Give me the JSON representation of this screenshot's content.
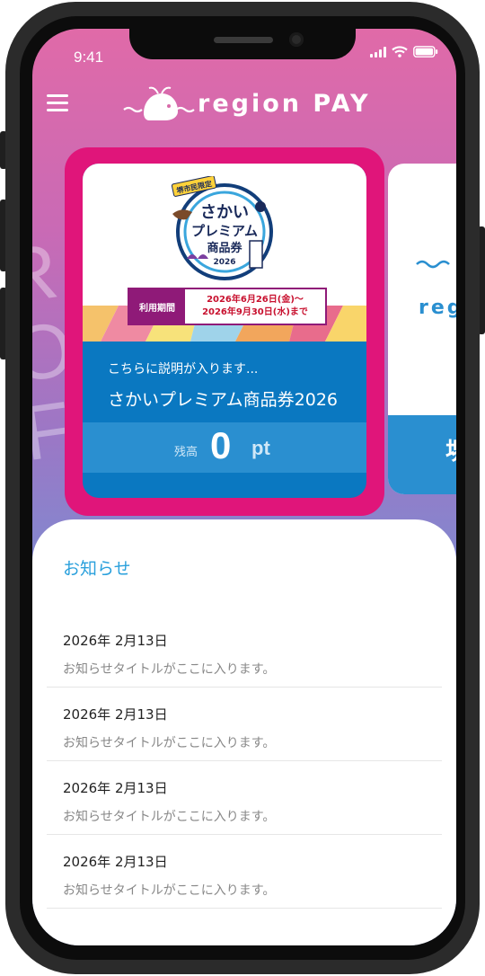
{
  "status_bar": {
    "time": "9:41"
  },
  "app": {
    "logo_text": "region PAY"
  },
  "card": {
    "period_label": "利用期間",
    "period_line1": "2026年6月26日(金)～",
    "period_line2": "2026年9月30日(水)まで",
    "description": "こちらに説明が入ります...",
    "name": "さかいプレミアム商品券2026",
    "balance_label": "残高",
    "balance_value": "0",
    "balance_unit": "pt"
  },
  "card_logo": {
    "badge": "堺市民限定",
    "line1": "さかい",
    "line2": "プレミアム",
    "line3": "商品券",
    "year": "2026"
  },
  "next_card": {
    "logo_fragment": "reg",
    "band_char": "堺"
  },
  "notices": {
    "title": "お知らせ",
    "items": [
      {
        "date": "2026年 2月13日",
        "title": "お知らせタイトルがここに入ります。"
      },
      {
        "date": "2026年 2月13日",
        "title": "お知らせタイトルがここに入ります。"
      },
      {
        "date": "2026年 2月13日",
        "title": "お知らせタイトルがここに入ります。"
      },
      {
        "date": "2026年 2月13日",
        "title": "お知らせタイトルがここに入ります。"
      }
    ]
  },
  "colors": {
    "card_outline": "#e0157a",
    "card_blue": "#0a78c1",
    "accent": "#2aa0dc"
  }
}
